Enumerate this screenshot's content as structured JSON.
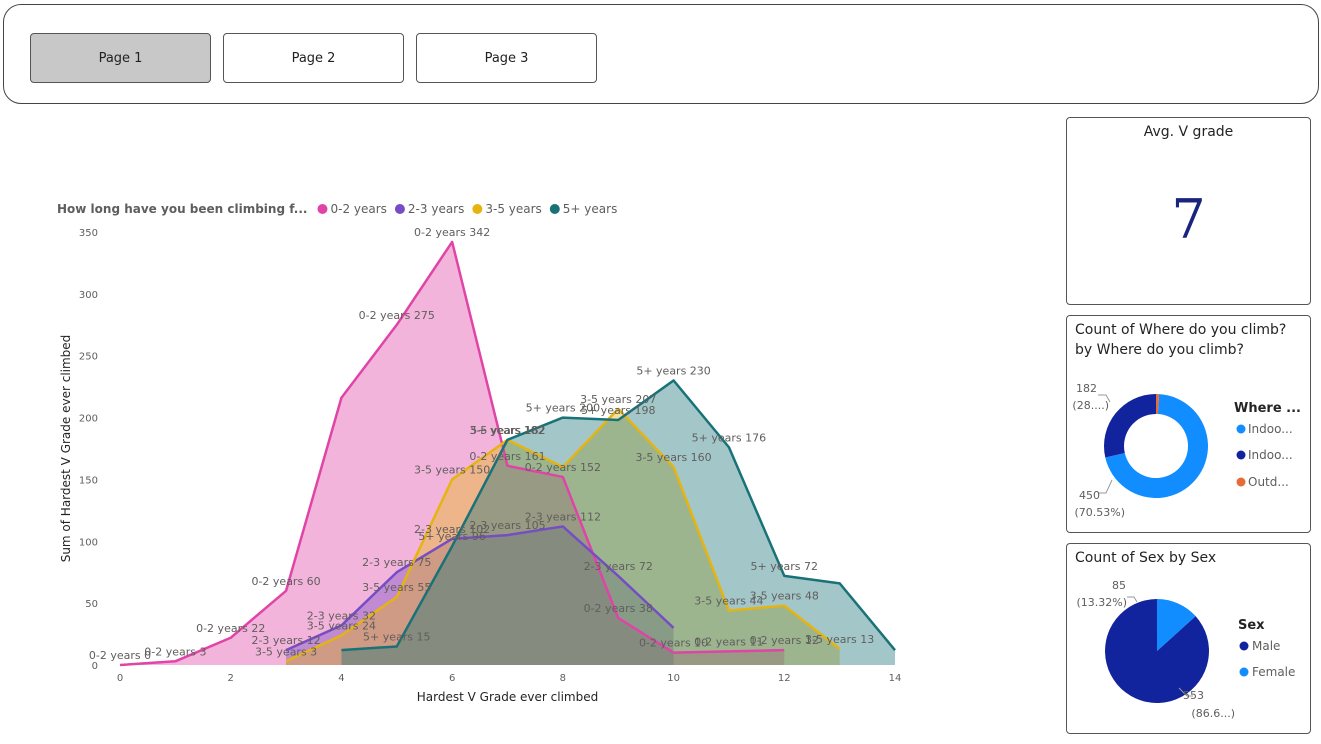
{
  "nav": {
    "buttons": [
      {
        "label": "Page 1",
        "active": true
      },
      {
        "label": "Page 2",
        "active": false
      },
      {
        "label": "Page 3",
        "active": false
      }
    ]
  },
  "kpi": {
    "title": "Avg. V grade",
    "value": "7"
  },
  "donut": {
    "title_line1": "Count of Where do you climb?",
    "title_line2": "by Where do you climb?",
    "legend_title": "Where ...",
    "legend": [
      {
        "label": "Indoo...",
        "color": "#118dff"
      },
      {
        "label": "Indoo...",
        "color": "#12239e"
      },
      {
        "label": "Outd...",
        "color": "#e66c37"
      }
    ],
    "callouts": [
      {
        "line1": "182",
        "line2": "(28....)"
      },
      {
        "line1": "450",
        "line2": "(70.53%)"
      }
    ]
  },
  "pie": {
    "title": "Count of Sex by Sex",
    "legend_title": "Sex",
    "legend": [
      {
        "label": "Male",
        "color": "#12239e"
      },
      {
        "label": "Female",
        "color": "#118dff"
      }
    ],
    "callouts": [
      {
        "line1": "85",
        "line2": "(13.32%)"
      },
      {
        "line1": "553",
        "line2": "(86.6...)"
      }
    ]
  },
  "chart_data": {
    "type": "area",
    "title": "",
    "xlabel": "Hardest V Grade ever climbed",
    "ylabel": "Sum of Hardest V Grade ever climbed",
    "xlim": [
      0,
      14
    ],
    "ylim": [
      0,
      350
    ],
    "x_ticks": [
      0,
      2,
      4,
      6,
      8,
      10,
      12,
      14
    ],
    "y_ticks": [
      0,
      50,
      100,
      150,
      200,
      250,
      300,
      350
    ],
    "grid": false,
    "legend_title": "How long have you been climbing f...",
    "legend_position": "top-left",
    "series": [
      {
        "name": "0-2 years",
        "color": "#e044a7",
        "points": [
          [
            0,
            0
          ],
          [
            1,
            3
          ],
          [
            2,
            22
          ],
          [
            3,
            60
          ],
          [
            4,
            216
          ],
          [
            5,
            275
          ],
          [
            6,
            342
          ],
          [
            7,
            161
          ],
          [
            8,
            152
          ],
          [
            9,
            38
          ],
          [
            10,
            10
          ],
          [
            11,
            11
          ],
          [
            12,
            12
          ]
        ],
        "labels": [
          {
            "x": 0,
            "y": 0,
            "text": "0-2 years 0"
          },
          {
            "x": 1,
            "y": 3,
            "text": "0-2 years 3"
          },
          {
            "x": 2,
            "y": 22,
            "text": "0-2 years 22"
          },
          {
            "x": 3,
            "y": 60,
            "text": "0-2 years 60"
          },
          {
            "x": 5,
            "y": 275,
            "text": "0-2 years 275"
          },
          {
            "x": 6,
            "y": 342,
            "text": "0-2 years 342"
          },
          {
            "x": 7,
            "y": 161,
            "text": "0-2 years 161"
          },
          {
            "x": 8,
            "y": 152,
            "text": "0-2 years 152"
          },
          {
            "x": 9,
            "y": 38,
            "text": "0-2 years 38"
          },
          {
            "x": 10,
            "y": 10,
            "text": "0-2 years 10"
          },
          {
            "x": 11,
            "y": 11,
            "text": "0-2 years 11"
          },
          {
            "x": 12,
            "y": 12,
            "text": "0-2 years 12"
          }
        ]
      },
      {
        "name": "2-3 years",
        "color": "#744ec2",
        "points": [
          [
            3,
            12
          ],
          [
            4,
            32
          ],
          [
            5,
            75
          ],
          [
            6,
            102
          ],
          [
            7,
            105
          ],
          [
            8,
            112
          ],
          [
            9,
            72
          ],
          [
            10,
            30
          ]
        ],
        "labels": [
          {
            "x": 3,
            "y": 12,
            "text": "2-3 years 12"
          },
          {
            "x": 4,
            "y": 32,
            "text": "2-3 years 32"
          },
          {
            "x": 5,
            "y": 75,
            "text": "2-3 years 75"
          },
          {
            "x": 6,
            "y": 102,
            "text": "2-3 years 102"
          },
          {
            "x": 7,
            "y": 105,
            "text": "2-3 years 105"
          },
          {
            "x": 8,
            "y": 112,
            "text": "2-3 years 112"
          },
          {
            "x": 9,
            "y": 72,
            "text": "2-3 years 72"
          }
        ]
      },
      {
        "name": "3-5 years",
        "color": "#e6b410",
        "points": [
          [
            3,
            3
          ],
          [
            4,
            24
          ],
          [
            5,
            55
          ],
          [
            6,
            150
          ],
          [
            7,
            182
          ],
          [
            8,
            160
          ],
          [
            9,
            207
          ],
          [
            10,
            160
          ],
          [
            11,
            44
          ],
          [
            12,
            48
          ],
          [
            13,
            13
          ]
        ],
        "labels": [
          {
            "x": 3,
            "y": 3,
            "text": "3-5 years 3"
          },
          {
            "x": 4,
            "y": 24,
            "text": "3-5 years 24"
          },
          {
            "x": 5,
            "y": 55,
            "text": "3-5 years 55"
          },
          {
            "x": 6,
            "y": 150,
            "text": "3-5 years 150"
          },
          {
            "x": 7,
            "y": 182,
            "text": "3-5 years 182"
          },
          {
            "x": 9,
            "y": 207,
            "text": "3-5 years 207"
          },
          {
            "x": 10,
            "y": 160,
            "text": "3-5 years 160"
          },
          {
            "x": 11,
            "y": 44,
            "text": "3-5 years 44"
          },
          {
            "x": 12,
            "y": 48,
            "text": "3-5 years 48"
          },
          {
            "x": 13,
            "y": 13,
            "text": "3-5 years 13"
          }
        ]
      },
      {
        "name": "5+ years",
        "color": "#197278",
        "points": [
          [
            4,
            12
          ],
          [
            5,
            15
          ],
          [
            6,
            96
          ],
          [
            7,
            182
          ],
          [
            8,
            200
          ],
          [
            9,
            198
          ],
          [
            10,
            230
          ],
          [
            11,
            176
          ],
          [
            12,
            72
          ],
          [
            13,
            66
          ],
          [
            14,
            12
          ]
        ],
        "labels": [
          {
            "x": 5,
            "y": 15,
            "text": "5+ years 15"
          },
          {
            "x": 6,
            "y": 96,
            "text": "5+ years 96"
          },
          {
            "x": 7,
            "y": 182,
            "text": "5+ years 182"
          },
          {
            "x": 8,
            "y": 200,
            "text": "5+ years 200"
          },
          {
            "x": 9,
            "y": 198,
            "text": "5+ years 198"
          },
          {
            "x": 10,
            "y": 230,
            "text": "5+ years 230"
          },
          {
            "x": 11,
            "y": 176,
            "text": "5+ years 176"
          },
          {
            "x": 12,
            "y": 72,
            "text": "5+ years 72"
          }
        ]
      }
    ]
  }
}
